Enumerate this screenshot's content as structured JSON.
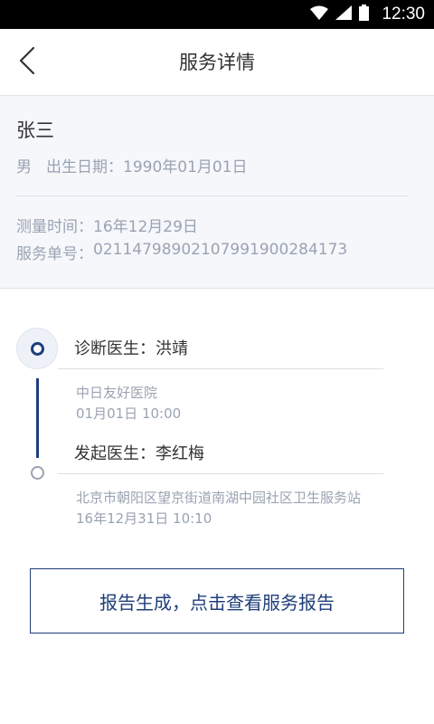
{
  "status_bar": {
    "time": "12:30",
    "icons": [
      "wifi-icon",
      "signal-icon",
      "battery-icon"
    ]
  },
  "header": {
    "title": "服务详情",
    "back_icon": "chevron-left-icon"
  },
  "patient": {
    "name": "张三",
    "gender": "男",
    "birth_label": "出生日期：",
    "birth_value": "1990年01月01日",
    "measure_label": "测量时间：",
    "measure_value": "16年12月29日",
    "order_label": "服务单号：",
    "order_value": "02114798902107991900284173"
  },
  "timeline": [
    {
      "role_label": "诊断医生：",
      "doctor": "洪靖",
      "hospital": "中日友好医院",
      "time": "01月01日 10:00"
    },
    {
      "role_label": "发起医生：",
      "doctor": "李红梅",
      "hospital": "北京市朝阳区望京街道南湖中园社区卫生服务站",
      "time": "16年12月31日 10:10"
    }
  ],
  "report_button": {
    "label": "报告生成，点击查看服务报告"
  },
  "colors": {
    "accent": "#1f3e7a",
    "muted_text": "#9aa3b2",
    "panel_bg": "#f5f7fb"
  }
}
